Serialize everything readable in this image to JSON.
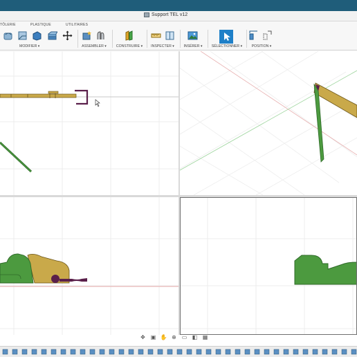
{
  "document": {
    "title": "Support TEL v12",
    "icon": "document-icon"
  },
  "ribbon": {
    "tabs": [
      "TÔLERIE",
      "PLASTIQUE",
      "UTILITAIRES"
    ],
    "groups": [
      {
        "label": "MODIFIER ▾"
      },
      {
        "label": "ASSEMBLER ▾"
      },
      {
        "label": "CONSTRUIRE ▾"
      },
      {
        "label": "INSPECTER ▾"
      },
      {
        "label": "INSÉRER ▾"
      },
      {
        "label": "SÉLECTIONNER ▾"
      },
      {
        "label": "POSITION ▾"
      }
    ]
  },
  "colors": {
    "titlebar": "#1f5d7a",
    "body_tan": "#c9a94a",
    "body_green": "#3f8f35",
    "body_purple": "#5a1f4a",
    "grid": "#e6e6e6",
    "axis_red": "#e7a9a9",
    "axis_green": "#9ed59e"
  },
  "navbar": {
    "icons": [
      "orbit-icon",
      "pan-icon",
      "look-at-icon",
      "zoom-icon",
      "display-settings-icon",
      "visual-style-icon",
      "grid-settings-icon"
    ]
  },
  "timeline": {
    "icons": [
      "timeline-feature-icon"
    ]
  }
}
